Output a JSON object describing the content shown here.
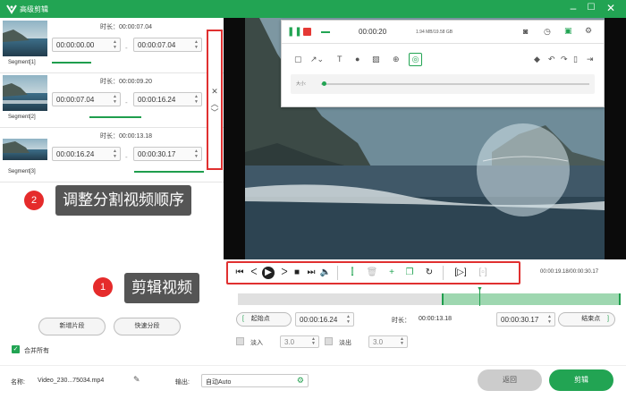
{
  "title_bar": {
    "title": "高级剪辑"
  },
  "segments": [
    {
      "label": "Segment[1]",
      "duration_label": "时长：",
      "duration": "00:00:07.04",
      "start": "00:00:00.00",
      "end": "00:00:07.04",
      "dash": "-"
    },
    {
      "label": "Segment[2]",
      "duration_label": "时长：",
      "duration": "00:00:09.20",
      "start": "00:00:07.04",
      "end": "00:00:16.24",
      "dash": "-"
    },
    {
      "label": "Segment[3]",
      "duration_label": "时长：",
      "duration": "00:00:13.18",
      "start": "00:00:16.24",
      "end": "00:00:30.17",
      "dash": "-"
    }
  ],
  "annotations": {
    "badge1": "1",
    "text1": "剪辑视频",
    "badge2": "2",
    "text2": "调整分割视频顺序"
  },
  "left_buttons": {
    "add": "新增片段",
    "quick_split": "快速分段"
  },
  "merge_all": "合并所有",
  "recorder": {
    "time": "00:00:20",
    "stats": "1.94 MB/19.58 GB",
    "size_label": "大小:"
  },
  "playback": {
    "time_display": "00:00:19.18/00:00:30.17"
  },
  "trim": {
    "start_btn": "起始点",
    "start_value": "00:00:16.24",
    "duration_label": "时长：",
    "duration_value": "00:00:13.18",
    "end_value": "00:00:30.17",
    "end_btn": "结束点"
  },
  "fade": {
    "fade_in_label": "淡入",
    "fade_in_value": "3.0",
    "fade_out_label": "淡出",
    "fade_out_value": "3.0"
  },
  "footer": {
    "name_label": "名称:",
    "file_name": "Video_230...75034.mp4",
    "output_label": "输出:",
    "output_value": "自动Auto",
    "back": "返回",
    "cut": "剪辑"
  },
  "colors": {
    "accent": "#22a453",
    "highlight": "#e03030"
  }
}
